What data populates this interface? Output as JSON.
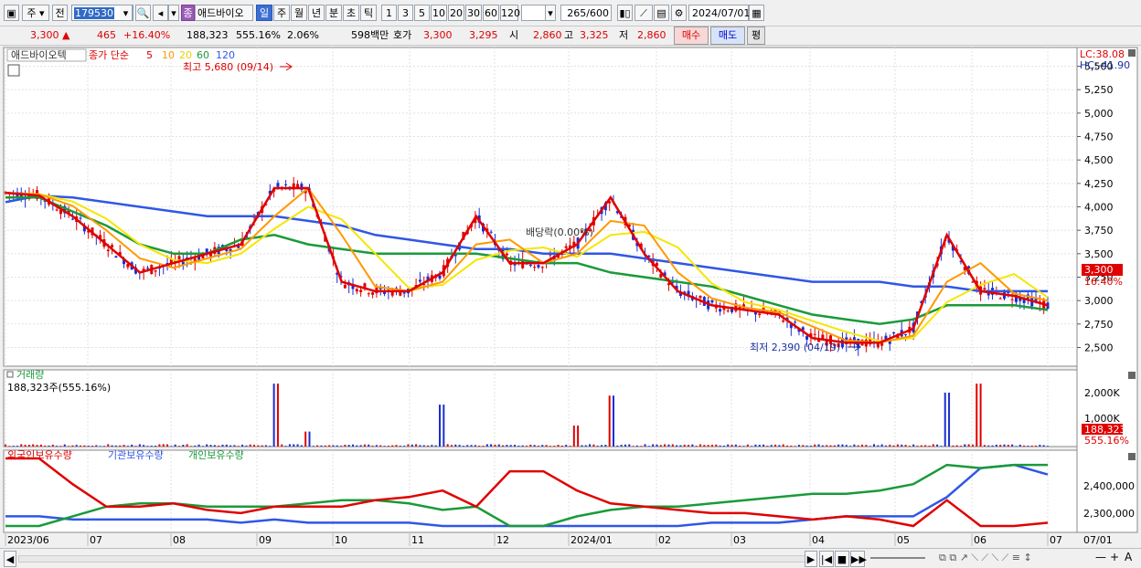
{
  "toolbar": {
    "period_type": "주",
    "prev_label": "전",
    "code": "179530",
    "stock_tag": "종",
    "stock_name": "애드바이오",
    "periods": [
      "일",
      "주",
      "월",
      "년",
      "분",
      "초",
      "틱"
    ],
    "active_period": "일",
    "intervals": [
      "1",
      "3",
      "5",
      "10",
      "20",
      "30",
      "60",
      "120"
    ],
    "count": "265",
    "count_max": "/600",
    "date": "2024/07/01"
  },
  "quote": {
    "price": "3,300",
    "change": "465",
    "change_pct": "+16.40%",
    "volume": "188,323",
    "volume_pct": "555.16%",
    "turnover": "2.06%",
    "amount": "598백만",
    "ask_label": "호가",
    "ask1": "3,300",
    "ask2": "3,295",
    "open_label": "시",
    "open": "2,860",
    "high_label": "고",
    "high": "3,325",
    "low_label": "저",
    "low": "2,860",
    "buy_label": "매수",
    "sell_label": "매도",
    "even_label": "평"
  },
  "price_panel": {
    "stock_label": "애드바이오텍",
    "ma_legend_prefix": "종가 단순",
    "ma_periods": [
      "5",
      "10",
      "20",
      "60",
      "120"
    ],
    "ma_colors": [
      "#e00000",
      "#ff9900",
      "#f5e600",
      "#1a9a3a",
      "#2f57e6"
    ],
    "high_note": "최고 5,680 (09/14)",
    "low_note": "최저 2,390 (04/19)",
    "dividend_note": "배당락(0.00%)",
    "lc": "LC:38.08",
    "hc": "HC:-41.90",
    "price_badge": "3,300",
    "pct_badge": "16.40%",
    "y_ticks": [
      "5,500",
      "5,250",
      "5,000",
      "4,750",
      "4,500",
      "4,250",
      "4,000",
      "3,750",
      "3,500",
      "3,250",
      "3,000",
      "2,750",
      "2,500"
    ]
  },
  "volume_panel": {
    "title": "거래량",
    "value": "188,323주(555.16%)",
    "y_ticks": [
      "2,000K",
      "1,000K"
    ],
    "badge": "188,323",
    "badge_pct": "555.16%"
  },
  "holding_panel": {
    "legend": [
      "외국인보유수량",
      "기관보유수량",
      "개인보유수량"
    ],
    "colors": [
      "#e00000",
      "#2f57e6",
      "#1a9a3a"
    ],
    "y_ticks": [
      "2,400,000",
      "2,300,000"
    ]
  },
  "x_axis": [
    "2023/06",
    "07",
    "08",
    "09",
    "10",
    "11",
    "12",
    "2024/01",
    "02",
    "03",
    "04",
    "05",
    "06",
    "07"
  ],
  "x_axis_right": "07/01",
  "chart_data": {
    "type": "candlestick",
    "x_range": [
      "2023/06",
      "2024/07/01"
    ],
    "ylim": [
      2300,
      5700
    ],
    "ma": {
      "ma5": [
        4150,
        4120,
        3900,
        3600,
        3300,
        3400,
        3500,
        3600,
        4200,
        4200,
        3200,
        3100,
        3100,
        3300,
        3900,
        3400,
        3400,
        3600,
        4100,
        3500,
        3100,
        2950,
        2900,
        2850,
        2600,
        2550,
        2550,
        2700,
        3700,
        3100,
        3050,
        2950
      ],
      "ma60": [
        4100,
        4100,
        3950,
        3800,
        3600,
        3500,
        3500,
        3650,
        3700,
        3600,
        3550,
        3500,
        3500,
        3500,
        3500,
        3450,
        3400,
        3400,
        3300,
        3250,
        3200,
        3150,
        3050,
        2950,
        2850,
        2800,
        2750,
        2800,
        2950,
        2950,
        2950,
        2900
      ],
      "ma120": [
        4050,
        4120,
        4100,
        4050,
        4000,
        3950,
        3900,
        3900,
        3900,
        3850,
        3800,
        3700,
        3650,
        3600,
        3550,
        3550,
        3500,
        3500,
        3500,
        3450,
        3400,
        3350,
        3300,
        3250,
        3200,
        3200,
        3200,
        3150,
        3150,
        3100,
        3100,
        3100
      ]
    },
    "volume_k": [
      0,
      0,
      0,
      0,
      0,
      0,
      0,
      0,
      2100,
      500,
      0,
      0,
      0,
      1400,
      0,
      0,
      0,
      700,
      1700,
      0,
      0,
      0,
      0,
      0,
      0,
      0,
      0,
      0,
      1800,
      2100,
      0,
      0
    ],
    "holdings": {
      "foreign": [
        2480000,
        2480000,
        2400000,
        2330000,
        2330000,
        2340000,
        2320000,
        2310000,
        2330000,
        2330000,
        2330000,
        2350000,
        2360000,
        2380000,
        2330000,
        2440000,
        2440000,
        2380000,
        2340000,
        2330000,
        2320000,
        2310000,
        2310000,
        2300000,
        2290000,
        2300000,
        2290000,
        2270000,
        2350000,
        2270000,
        2270000,
        2280000
      ],
      "institution": [
        2300000,
        2300000,
        2290000,
        2290000,
        2290000,
        2290000,
        2290000,
        2280000,
        2290000,
        2280000,
        2280000,
        2280000,
        2280000,
        2270000,
        2270000,
        2270000,
        2270000,
        2270000,
        2270000,
        2270000,
        2270000,
        2280000,
        2280000,
        2280000,
        2290000,
        2300000,
        2300000,
        2300000,
        2360000,
        2450000,
        2460000,
        2430000
      ],
      "individual": [
        2270000,
        2270000,
        2300000,
        2330000,
        2340000,
        2340000,
        2330000,
        2330000,
        2330000,
        2340000,
        2350000,
        2350000,
        2340000,
        2320000,
        2330000,
        2270000,
        2270000,
        2300000,
        2320000,
        2330000,
        2330000,
        2340000,
        2350000,
        2360000,
        2370000,
        2370000,
        2380000,
        2400000,
        2460000,
        2450000,
        2460000,
        2460000
      ]
    }
  },
  "bottom": {
    "nav": [
      "◀",
      "▶",
      "|◀",
      "◀◀",
      "■",
      "▶▶"
    ],
    "zoom": [
      "—",
      "+",
      "A"
    ]
  }
}
